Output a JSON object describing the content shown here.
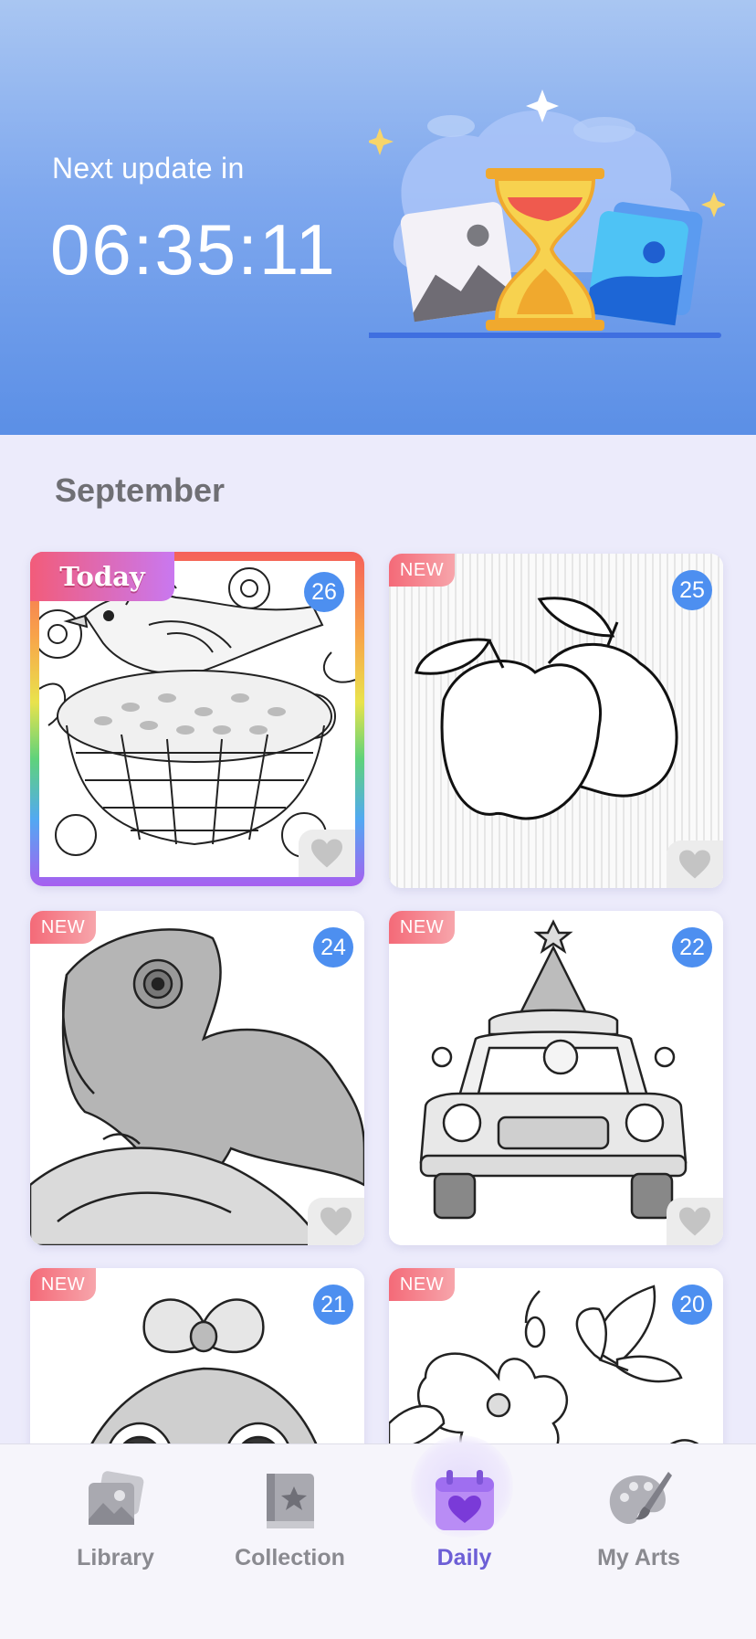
{
  "header": {
    "next_update_label": "Next update in",
    "countdown": "06:35:11"
  },
  "month": "September",
  "cards": [
    {
      "badge": "Today",
      "day": "26",
      "subject": "bird-on-seed-basket"
    },
    {
      "badge": "NEW",
      "day": "25",
      "subject": "two-apples"
    },
    {
      "badge": "NEW",
      "day": "24",
      "subject": "chameleon"
    },
    {
      "badge": "NEW",
      "day": "22",
      "subject": "car-with-christmas-tree"
    },
    {
      "badge": "NEW",
      "day": "21",
      "subject": "cute-creature-with-bow"
    },
    {
      "badge": "NEW",
      "day": "20",
      "subject": "hibiscus-and-butterfly"
    }
  ],
  "nav": {
    "items": [
      {
        "label": "Library",
        "icon": "library-icon"
      },
      {
        "label": "Collection",
        "icon": "collection-icon"
      },
      {
        "label": "Daily",
        "icon": "daily-calendar-icon",
        "active": true
      },
      {
        "label": "My Arts",
        "icon": "palette-icon"
      }
    ]
  },
  "colors": {
    "accent": "#6d5fd6",
    "day_badge": "#4d8ff0",
    "new_badge": "#f46a78",
    "banner_top": "#a9c6f2",
    "banner_bottom": "#5b8fe6"
  }
}
